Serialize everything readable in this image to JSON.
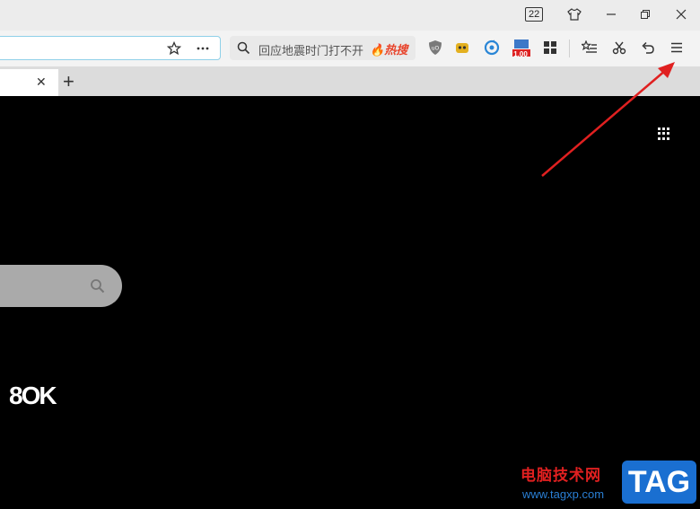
{
  "titlebar": {
    "badge_count": "22",
    "icons": [
      "skin-icon",
      "minimize-icon",
      "restore-icon",
      "close-icon"
    ]
  },
  "toolbar": {
    "address_value": "",
    "search_placeholder": "回应地震时门打不开",
    "hot_label": "热搜",
    "ext_badge": "1.00"
  },
  "tabbar": {
    "new_tab_label": "+",
    "close_label": "✕"
  },
  "content": {
    "search_value": "",
    "logo_text": "8OK"
  },
  "watermark": {
    "title": "电脑技术网",
    "url": "www.tagxp.com",
    "tag": "TAG"
  },
  "colors": {
    "annotation_arrow": "#e02020",
    "address_border": "#8fd0e8",
    "hot": "#e8442c",
    "tag_bg": "#1a6fd1"
  }
}
